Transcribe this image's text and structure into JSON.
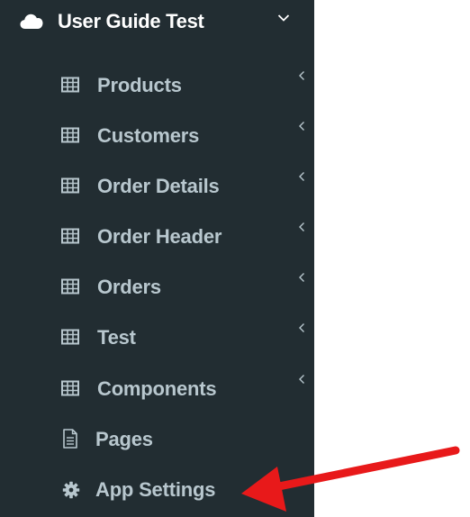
{
  "project": {
    "title": "User Guide Test",
    "icon": "cloud-icon",
    "expanded_icon": "chevron-down-icon"
  },
  "menu": {
    "items": [
      {
        "label": "Products",
        "icon": "table-icon",
        "has_submenu": true
      },
      {
        "label": "Customers",
        "icon": "table-icon",
        "has_submenu": true
      },
      {
        "label": "Order Details",
        "icon": "table-icon",
        "has_submenu": true
      },
      {
        "label": "Order Header",
        "icon": "table-icon",
        "has_submenu": true
      },
      {
        "label": "Orders",
        "icon": "table-icon",
        "has_submenu": true
      },
      {
        "label": "Test",
        "icon": "table-icon",
        "has_submenu": true
      },
      {
        "label": "Components",
        "icon": "table-icon",
        "has_submenu": true
      },
      {
        "label": "Pages",
        "icon": "document-icon",
        "has_submenu": false
      },
      {
        "label": "App Settings",
        "icon": "gear-icon",
        "has_submenu": false
      }
    ]
  },
  "annotation": {
    "type": "red-arrow",
    "color": "#e8191a",
    "points_to": "App Settings"
  },
  "colors": {
    "sidebar_bg": "#222d32",
    "menu_text": "#b8c7ce",
    "header_text": "#ffffff"
  }
}
